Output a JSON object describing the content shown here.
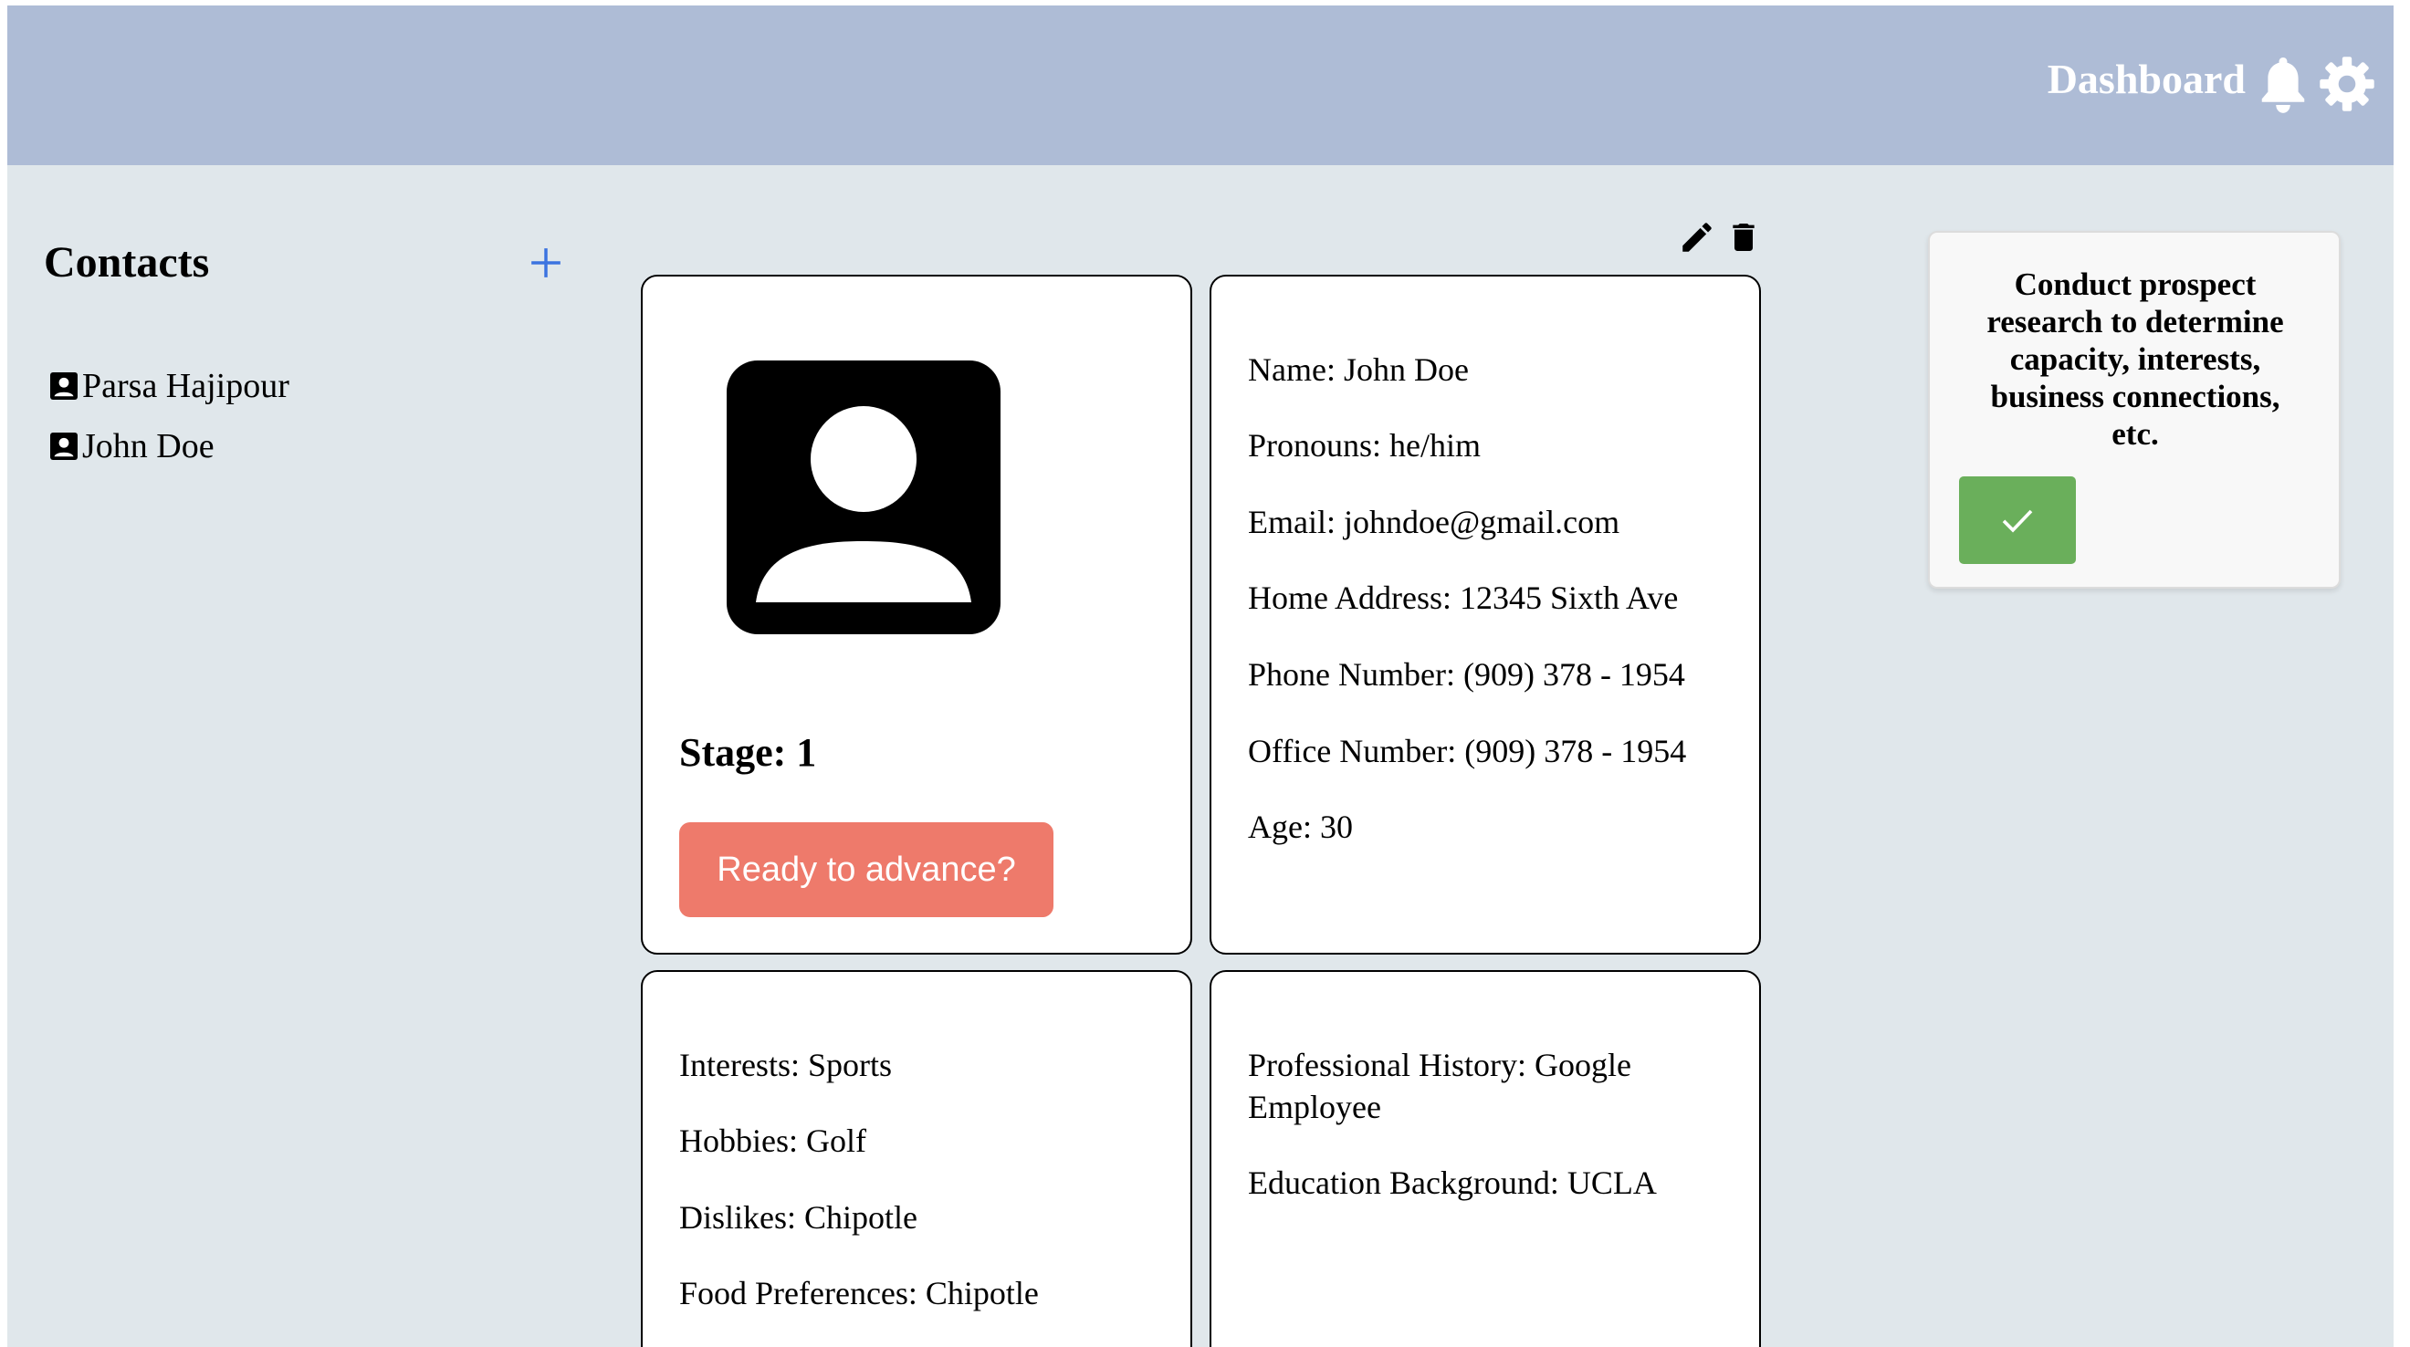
{
  "header": {
    "title": "Dashboard",
    "icons": [
      "bell-icon",
      "gear-icon"
    ]
  },
  "sidebar": {
    "title": "Contacts",
    "add_icon": "plus-icon",
    "contacts": [
      {
        "name": "Parsa Hajipour",
        "icon": "contact-card-icon"
      },
      {
        "name": "John Doe",
        "icon": "contact-card-icon"
      }
    ]
  },
  "profile": {
    "tools": [
      "pencil-icon",
      "trash-icon"
    ],
    "stage_label": "Stage: 1",
    "advance_label": "Ready to advance?",
    "info": {
      "name": "Name: John Doe",
      "pronouns": "Pronouns: he/him",
      "email": "Email: johndoe@gmail.com",
      "home_address": "Home Address: 12345 Sixth Ave",
      "phone": "Phone Number: (909) 378 - 1954",
      "office": "Office Number: (909) 378 - 1954",
      "age": "Age: 30"
    },
    "personal": {
      "interests": "Interests: Sports",
      "hobbies": "Hobbies: Golf",
      "dislikes": "Dislikes: Chipotle",
      "food": "Food Preferences: Chipotle"
    },
    "professional": {
      "history": "Professional History: Google Employee",
      "education": "Education Background: UCLA"
    }
  },
  "task": {
    "text": "Conduct prospect research to determine capacity, interests, business connections, etc.",
    "complete_icon": "checkmark-icon"
  },
  "colors": {
    "header_bg": "#aebcd6",
    "page_bg": "#e0e7eb",
    "advance_button": "#ee7a6b",
    "complete_button": "#6aaf5b",
    "add_icon": "#3b73e0"
  }
}
